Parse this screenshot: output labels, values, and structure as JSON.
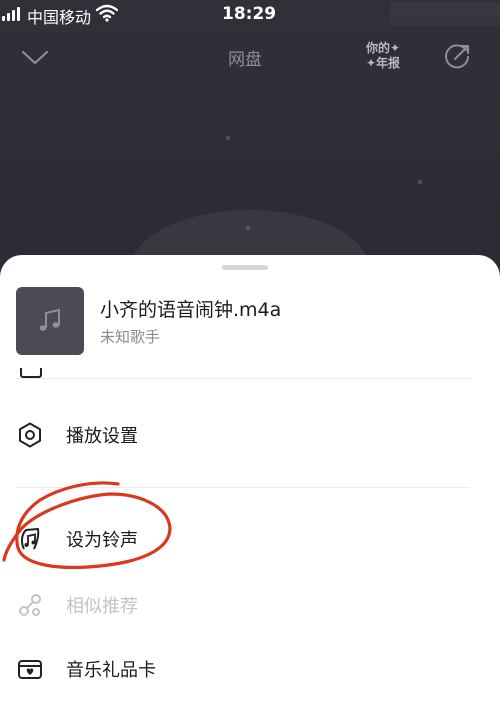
{
  "status_bar": {
    "carrier": "中国移动",
    "time": "18:29"
  },
  "header": {
    "title": "网盘",
    "year_report_line1": "你的✦",
    "year_report_line2": "✦年报",
    "icons": [
      "chevron-down-icon",
      "share-icon"
    ]
  },
  "song": {
    "title": "小齐的语音闹钟.m4a",
    "artist": "未知歌手",
    "cover_icon": "music-note-icon"
  },
  "menu": {
    "items": [
      {
        "label": "播放设置",
        "icon": "hexagon-settings-icon",
        "enabled": true
      },
      {
        "label": "设为铃声",
        "icon": "ringtone-icon",
        "enabled": true,
        "annotated": true
      },
      {
        "label": "相似推荐",
        "icon": "similar-icon",
        "enabled": false
      },
      {
        "label": "音乐礼品卡",
        "icon": "gift-card-icon",
        "enabled": true
      }
    ]
  },
  "colors": {
    "annotation": "#d8391f",
    "player_bg": "#2b2c36",
    "sheet_bg": "#ffffff"
  }
}
